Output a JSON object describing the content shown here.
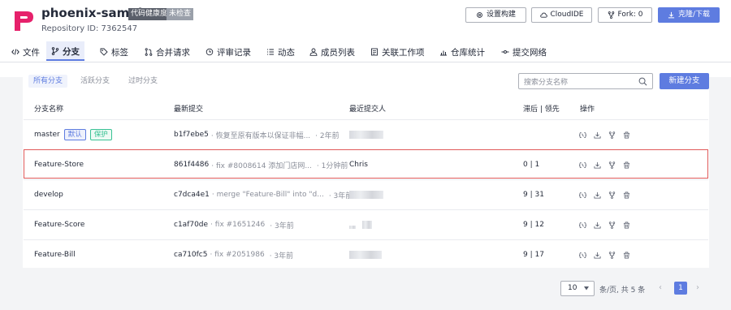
{
  "repo": {
    "name": "phoenix-sample",
    "tag_health": "代码健康度",
    "tag_status": "未检查",
    "id_label": "Repository ID: 7362547"
  },
  "header_buttons": {
    "settings": "设置构建",
    "cloudide": "CloudIDE",
    "fork": "Fork: 0",
    "clone": "克隆/下载"
  },
  "tabs": [
    {
      "label": "文件",
      "icon": "code-icon"
    },
    {
      "label": "分支",
      "icon": "branch-icon"
    },
    {
      "label": "标签",
      "icon": "tag-icon"
    },
    {
      "label": "合并请求",
      "icon": "merge-icon"
    },
    {
      "label": "评审记录",
      "icon": "review-icon"
    },
    {
      "label": "动态",
      "icon": "activity-icon"
    },
    {
      "label": "成员列表",
      "icon": "members-icon"
    },
    {
      "label": "关联工作项",
      "icon": "workitem-icon"
    },
    {
      "label": "仓库统计",
      "icon": "stats-icon"
    },
    {
      "label": "提交网络",
      "icon": "network-icon"
    }
  ],
  "subtabs": [
    "所有分支",
    "活跃分支",
    "过时分支"
  ],
  "search": {
    "placeholder": "搜索分支名称"
  },
  "new_branch": "新建分支",
  "table": {
    "headers": [
      "分支名称",
      "最新提交",
      "最近提交人",
      "滞后 | 领先",
      "操作"
    ],
    "rows": [
      {
        "name": "master",
        "badges": [
          "默认",
          "保护"
        ],
        "commit": "b1f7ebe5",
        "message": "· 恢复至原有版本以保证非幅...",
        "time": "· 2年前",
        "committer": "",
        "behind_ahead": "",
        "highlight": false
      },
      {
        "name": "Feature-Store",
        "badges": [],
        "commit": "861f4486",
        "message": "· fix #8008614 添加门店网...",
        "time": "· 1分钟前",
        "committer": "Chris",
        "behind_ahead": "0 | 1",
        "highlight": true
      },
      {
        "name": "develop",
        "badges": [],
        "commit": "c7dca4e1",
        "message": "· merge \"Feature-Bill\" into \"d...",
        "time": "· 3年前",
        "committer": "",
        "behind_ahead": "9 | 31",
        "highlight": false
      },
      {
        "name": "Feature-Score",
        "badges": [],
        "commit": "c1af70de",
        "message": "· fix #1651246",
        "time": "· 3年前",
        "committer": "",
        "behind_ahead": "9 | 12",
        "highlight": false
      },
      {
        "name": "Feature-Bill",
        "badges": [],
        "commit": "ca710fc5",
        "message": "· fix #2051986",
        "time": "· 3年前",
        "committer": "",
        "behind_ahead": "9 | 17",
        "highlight": false
      }
    ]
  },
  "pagination": {
    "page_size": "10",
    "summary": "条/页, 共 5 条",
    "current": "1",
    "prev": "‹",
    "next": "›"
  },
  "colors": {
    "accent": "#5e7ce0",
    "highlight_border": "#e05a5a",
    "protect": "#3ac295"
  }
}
